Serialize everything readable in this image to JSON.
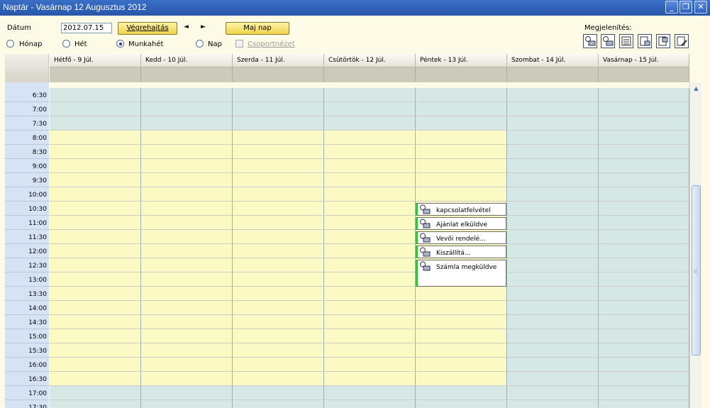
{
  "window": {
    "title": "Naptár - Vasárnap 12 Augusztus 2012",
    "min": "_",
    "max": "❐",
    "close": "✕"
  },
  "toolbar": {
    "date_label": "Dátum",
    "date_value": "2012.07.15",
    "execute_label": "Végrehajtás",
    "prev_icon": "◄",
    "next_icon": "►",
    "today_label": "Maj nap",
    "display_label": "Megjelenítés:",
    "views": [
      {
        "label": "Hónap",
        "selected": false
      },
      {
        "label": "Hét",
        "selected": false
      },
      {
        "label": "Munkahét",
        "selected": true
      },
      {
        "label": "Nap",
        "selected": false
      }
    ],
    "group_view_label": "Csoportnézet"
  },
  "days": [
    "Hétfő - 9 Júl.",
    "Kedd - 10 Júl.",
    "Szerda - 11 Júl.",
    "Csütörtök - 12 Júl.",
    "Péntek - 13 Júl.",
    "Szombat - 14 Júl.",
    "Vasárnap - 15 Júl."
  ],
  "times": [
    "6:30",
    "7:00",
    "7:30",
    "8:00",
    "8:30",
    "9:00",
    "9:30",
    "10:00",
    "10:30",
    "11:00",
    "11:30",
    "12:00",
    "12:30",
    "13:00",
    "13:30",
    "14:00",
    "14:30",
    "15:00",
    "15:30",
    "16:00",
    "16:30",
    "17:00",
    "17:30"
  ],
  "appointments": [
    {
      "title": "kapcsolatfelvétel"
    },
    {
      "title": "Ajánlat elküldve"
    },
    {
      "title": "Vevői rendelé..."
    },
    {
      "title": "Kiszállítá..."
    },
    {
      "title": "Számla megküldve"
    }
  ],
  "colors": {
    "working_hours": "#fbf9c4",
    "off_hours": "#d5e8e6",
    "time_column": "#d6e3f4",
    "appointment_marker": "#39c13a"
  }
}
